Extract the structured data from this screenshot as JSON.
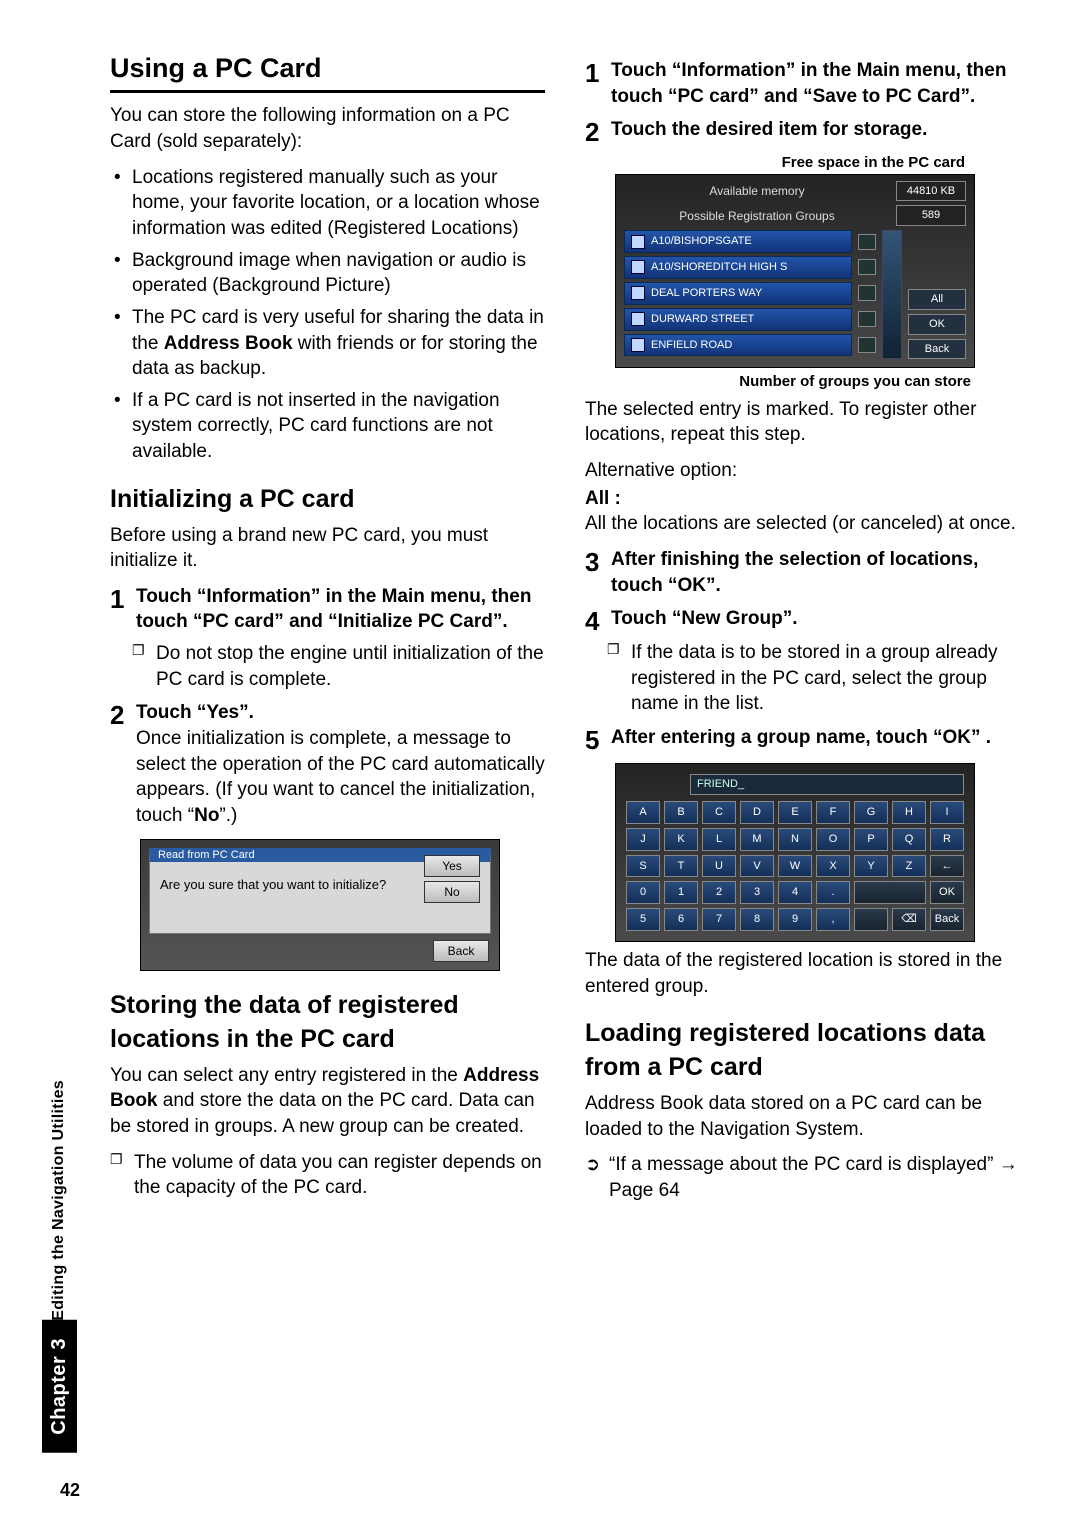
{
  "sidebar": {
    "chapter": "Chapter 3",
    "utilities": "Editing the Navigation Utilities"
  },
  "left": {
    "h_using": "Using a PC Card",
    "p_store": "You can store the following information on a PC Card (sold separately):",
    "bullets": [
      "Locations registered manually such as your home, your favorite location, or a location whose information was edited (Registered Locations)",
      "Background image when navigation or audio is operated (Background Picture)",
      "The PC card is very useful for sharing the data in the Address Book with friends or for storing the data as backup.",
      "If a PC card is not inserted in the navigation system correctly, PC card functions are not available."
    ],
    "bold_in_b3": "Address Book",
    "h_init": "Initializing a PC card",
    "p_init": "Before using a brand new PC card, you must initialize it.",
    "step1": "Touch “Information” in the Main menu, then touch “PC card” and “Initialize PC Card”.",
    "step1_note": "Do not stop the engine until initialization of the PC card is complete.",
    "step2_title": "Touch “Yes”.",
    "step2_body_a": "Once initialization is complete, a message to select the operation of the PC card automatically appears. (If you want to cancel the initialization, touch “",
    "step2_bold": "No",
    "step2_body_b": "”.)",
    "dlg": {
      "title": "Read from PC Card",
      "msg": "Are you sure that you want to initialize?",
      "yes": "Yes",
      "no": "No",
      "back": "Back"
    },
    "h_store": "Storing the data of registered locations in the PC card",
    "p_store2_a": "You can select any entry registered in the ",
    "p_store2_bold": "Address Book",
    "p_store2_b": " and store the data on the PC card. Data can be stored in groups. A new group can be created.",
    "store_note": "The volume of data you can register depends on the capacity of the PC card."
  },
  "right": {
    "step1": "Touch “Information” in the Main menu, then touch “PC card” and “Save to PC Card”.",
    "step2": "Touch the desired item for storage.",
    "fig1": {
      "label_top": "Free space in the PC card",
      "avail": "Available memory",
      "avail_val": "44810 KB",
      "groups": "Possible Registration Groups",
      "groups_val": "589",
      "rows": [
        "A10/BISHOPSGATE",
        "A10/SHOREDITCH HIGH S",
        "DEAL PORTERS WAY",
        "DURWARD STREET",
        "ENFIELD ROAD"
      ],
      "btn_all": "All",
      "btn_ok": "OK",
      "btn_back": "Back",
      "label_bot": "Number of groups you can store"
    },
    "p_after_fig1": "The selected entry is marked. To register other locations, repeat this step.",
    "p_alt": "Alternative option:",
    "all_lbl": "All :",
    "all_body": "All the locations are selected (or canceled) at once.",
    "step3": "After finishing the selection of locations, touch “OK”.",
    "step4": "Touch “New Group”.",
    "step4_note": "If the data is to be stored in a group already registered in the PC card, select the group name in the list.",
    "step5": "After entering a group name, touch “OK” .",
    "kb": {
      "input": "FRIEND_",
      "rows": [
        [
          "A",
          "B",
          "C",
          "D",
          "E",
          "F",
          "G",
          "H",
          "I"
        ],
        [
          "J",
          "K",
          "L",
          "M",
          "N",
          "O",
          "P",
          "Q",
          "R"
        ],
        [
          "S",
          "T",
          "U",
          "V",
          "W",
          "X",
          "Y",
          "Z",
          "←"
        ],
        [
          "0",
          "1",
          "2",
          "3",
          "4",
          ".",
          "",
          "",
          "OK"
        ],
        [
          "5",
          "6",
          "7",
          "8",
          "9",
          ",",
          "",
          "⌫",
          "Back"
        ]
      ]
    },
    "p_after_kb": "The data of the registered location is stored in the entered group.",
    "h_load": "Loading registered locations data from a PC card",
    "p_load": "Address Book data stored on a PC card can be loaded to the Navigation System.",
    "xref": "“If a message about the PC card is displayed” → Page 64"
  },
  "page_number": "42"
}
